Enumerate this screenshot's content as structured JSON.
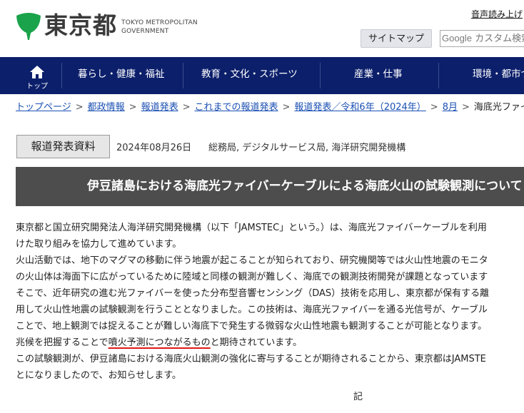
{
  "header": {
    "logo_jp": "東京都",
    "logo_en_line1": "TOKYO METROPOLITAN",
    "logo_en_line2": "GOVERNMENT",
    "voice_link": "音声読み上げ",
    "sitemap_label": "サイトマップ",
    "search_brand": "Google",
    "search_placeholder": "カスタム検索"
  },
  "nav": {
    "home_label": "トップ",
    "items": [
      {
        "label": "暮らし・健康・福祉"
      },
      {
        "label": "教育・文化・スポーツ"
      },
      {
        "label": "産業・仕事"
      },
      {
        "label": "環境・都市づくり"
      }
    ],
    "bg_color": "#0b1f6b"
  },
  "breadcrumb": {
    "items": [
      "トップページ",
      "都政情報",
      "報道発表",
      "これまでの報道発表",
      "報道発表／令和6年（2024年）",
      "8月"
    ],
    "current": "海底光ファイバー"
  },
  "press": {
    "badge": "報道発表資料",
    "date": "2024年08月26日",
    "bureaus": "総務局, デジタルサービス局, 海洋研究開発機構",
    "title": "伊豆諸島における海底光ファイバーケーブルによる海底火山の試験観測について"
  },
  "body": {
    "line1": "東京都と国立研究開発法人海洋研究開発機構（以下「JAMSTEC」という。）は、海底光ファイバーケーブルを利用",
    "line2": "けた取り組みを協力して進めています。",
    "line3": "火山活動では、地下のマグマの移動に伴う地震が起こることが知られており、研究機関等では火山性地震のモニタ",
    "line4": "の火山体は海面下に広がっているために陸域と同様の観測が難しく、海底での観測技術開発が課題となっています",
    "line5": "そこで、近年研究の進む光ファイバーを使った分布型音響センシング（DAS）技術を応用し、東京都が保有する離",
    "line6": "用して火山性地震の試験観測を行うこととなりました。この技術は、海底光ファイバーを通る光信号が、ケーブル",
    "line7": "ことで、地上観測では捉えることが難しい海底下で発生する微弱な火山性地震も観測することが可能となります。",
    "line8_pre": "兆候を把握することで",
    "line8_hl": "噴火予測につながるもの",
    "line8_post": "と期待されています。",
    "line9": "この試験観測が、伊豆諸島における海底火山観測の強化に寄与することが期待されることから、東京都はJAMSTE",
    "line10": "とになりましたので、お知らせします。",
    "ki": "記",
    "highlight_color": "#e01818"
  }
}
